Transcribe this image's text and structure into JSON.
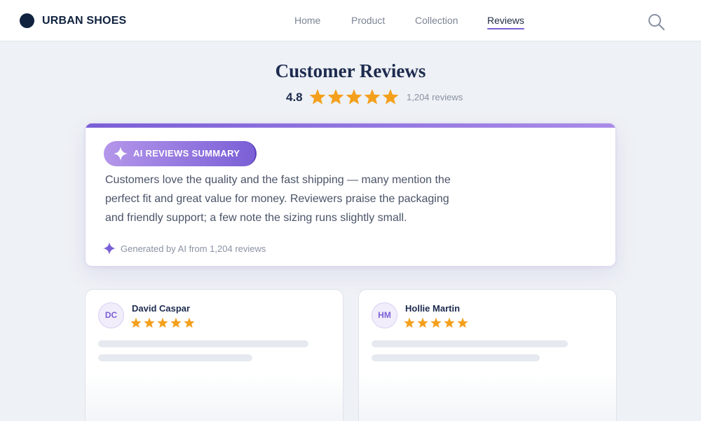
{
  "header": {
    "brand": "URBAN SHOES",
    "nav": [
      {
        "label": "Home"
      },
      {
        "label": "Product"
      },
      {
        "label": "Collection"
      },
      {
        "label": "Reviews",
        "active": true
      }
    ],
    "search_icon": "search-icon"
  },
  "page": {
    "title": "Customer Reviews",
    "rating": "4.8",
    "star_count": 5,
    "review_count": "1,204 reviews"
  },
  "ai_summary": {
    "badge_label": "AI REVIEWS SUMMARY",
    "badge_icon": "sparkle-icon",
    "line_1": "Customers love the quality and the fast shipping — many mention the",
    "line_2": "perfect fit and great value for money. Reviewers praise the packaging",
    "line_3": "and friendly support; a few note the sizing runs slightly small.",
    "footer": "Generated by AI from 1,204 reviews"
  },
  "reviews": [
    {
      "initials": "DC",
      "name": "David Caspar",
      "stars": 5
    },
    {
      "initials": "HM",
      "name": "Hollie Martin",
      "stars": 5
    }
  ],
  "colors": {
    "accent": "#7a5fd6",
    "star": "#f4a01c",
    "brand_dark": "#10223e"
  }
}
